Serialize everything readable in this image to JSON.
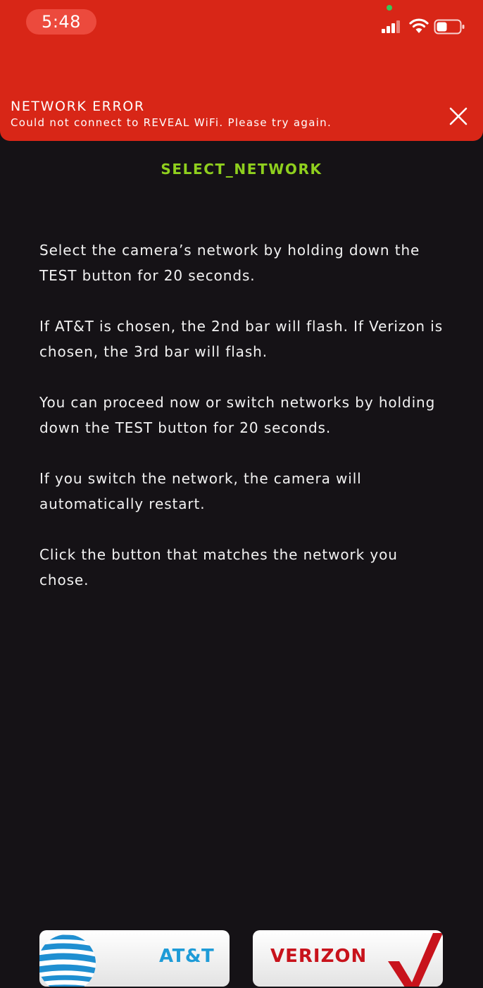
{
  "status_bar": {
    "time": "5:48",
    "signal_icon": "cellular-signal-icon",
    "wifi_icon": "wifi-icon",
    "battery_icon": "battery-icon",
    "camera_indicator_color": "#34c759"
  },
  "error_banner": {
    "title": "NETWORK ERROR",
    "message": "Could not connect to REVEAL WiFi. Please try again.",
    "close_icon": "close-icon",
    "background_color": "#d82617"
  },
  "page": {
    "title": "SELECT_NETWORK",
    "title_color": "#8fcf1e",
    "paragraphs": [
      "Select the camera’s network by holding down the TEST button for 20 seconds.",
      "If AT&T is chosen, the 2nd bar will flash. If Verizon is chosen, the 3rd bar will flash.",
      "You can proceed now or switch networks by holding down the TEST button for 20 seconds.",
      "If you switch the network, the camera will automatically restart.",
      "Click the button that matches the network you chose."
    ]
  },
  "buttons": {
    "att": {
      "label": "AT&T",
      "icon": "att-globe-icon",
      "color": "#1e9bd7"
    },
    "verizon": {
      "label": "VERIZON",
      "icon": "verizon-check-icon",
      "color": "#c8131c"
    }
  }
}
